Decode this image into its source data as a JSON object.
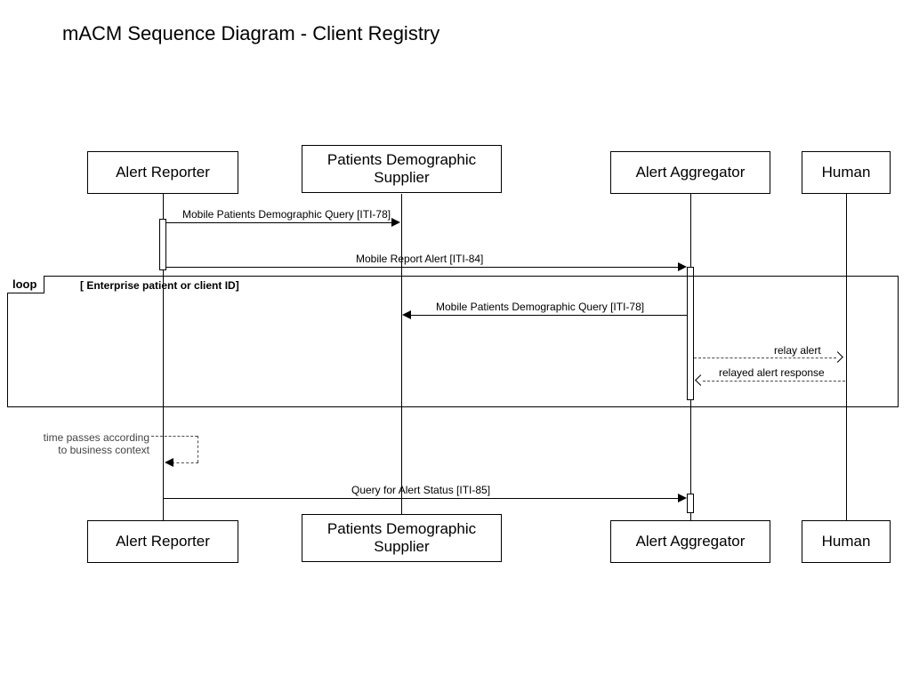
{
  "title": "mACM Sequence Diagram  -  Client Registry",
  "participants": {
    "p1": "Alert Reporter",
    "p2": "Patients Demographic\nSupplier",
    "p3": "Alert Aggregator",
    "p4": "Human"
  },
  "loop": {
    "operator": "loop",
    "guard": "[ Enterprise patient or client ID]"
  },
  "messages": {
    "m1": "Mobile Patients Demographic Query [ITI-78]",
    "m2": "Mobile Report Alert [ITI-84]",
    "m3": "Mobile Patients Demographic Query [ITI-78]",
    "m4": "relay alert",
    "m5": "relayed alert response",
    "m6": "Query for Alert Status [ITI-85]"
  },
  "note": "time passes according\nto business context"
}
